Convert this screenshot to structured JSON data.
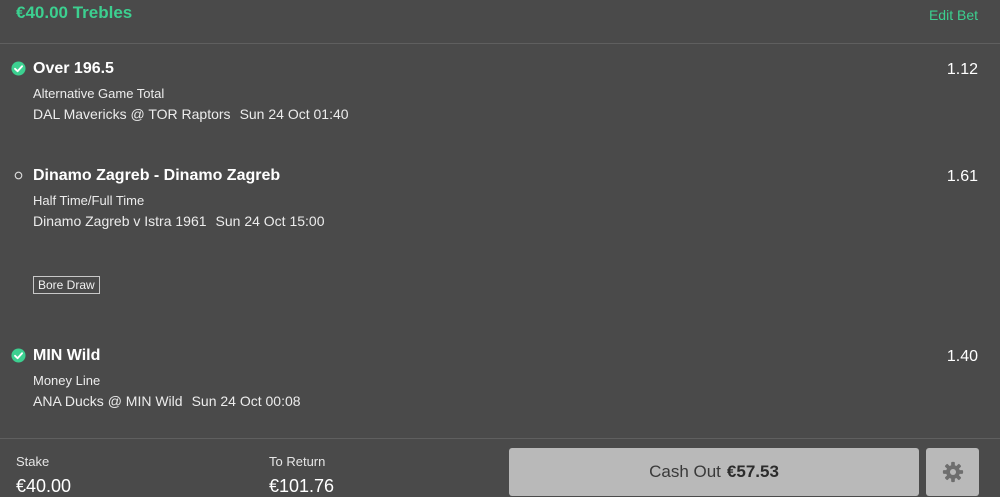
{
  "header": {
    "title": "€40.00 Trebles",
    "edit_label": "Edit Bet"
  },
  "selections": [
    {
      "status": "won",
      "name": "Over 196.5",
      "odds": "1.12",
      "market": "Alternative Game Total",
      "event": "DAL Mavericks @ TOR Raptors",
      "time": "Sun 24 Oct 01:40"
    },
    {
      "status": "pending",
      "name": "Dinamo Zagreb - Dinamo Zagreb",
      "odds": "1.61",
      "market": "Half Time/Full Time",
      "event": "Dinamo Zagreb v Istra 1961",
      "time": "Sun 24 Oct 15:00",
      "tag": "Bore Draw"
    },
    {
      "status": "won",
      "name": "MIN Wild",
      "odds": "1.40",
      "market": "Money Line",
      "event": "ANA Ducks @ MIN Wild",
      "time": "Sun 24 Oct 00:08"
    }
  ],
  "footer": {
    "stake_label": "Stake",
    "stake_value": "€40.00",
    "return_label": "To Return",
    "return_value": "€101.76",
    "cashout_label": "Cash Out",
    "cashout_amount": "€57.53",
    "settings_icon": "gear-icon"
  },
  "colors": {
    "accent": "#3cd090",
    "background": "#4a4a4a",
    "button": "#b9b9b9"
  }
}
